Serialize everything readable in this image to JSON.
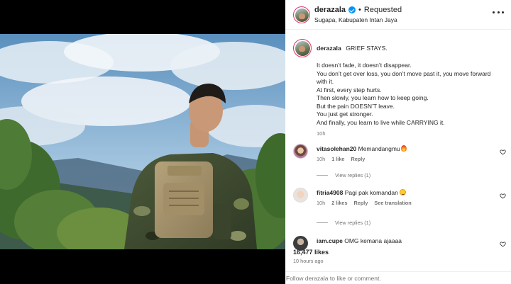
{
  "post": {
    "username": "derazala",
    "separator": "•",
    "follow_status": "Requested",
    "location": "Sugapa, Kabupaten Intan Jaya"
  },
  "caption": {
    "username": "derazala",
    "title": "GRIEF STAYS.",
    "lines": [
      "It doesn’t fade, it doesn’t disappear.",
      "You don’t get over loss, you don’t move past it, you move forward",
      "with it.",
      "At first, every step hurts.",
      "Then slowly, you learn how to keep going.",
      "But the pain DOESN’T leave.",
      "You just get stronger.",
      "And finally, you learn to live while CARRYING it."
    ],
    "time": "10h"
  },
  "comments": [
    {
      "username": "vitasolehan20",
      "text": "Memandangmu",
      "emoji": "fire-emoji",
      "time": "10h",
      "likes": "1 like",
      "reply": "Reply",
      "translate": "",
      "view_replies": "View replies (1)"
    },
    {
      "username": "fitria4908",
      "text": "Pagi pak komandan",
      "emoji": "smile-emoji",
      "time": "10h",
      "likes": "2 likes",
      "reply": "Reply",
      "translate": "See translation",
      "view_replies": "View replies (1)"
    },
    {
      "username": "iam.cupe",
      "text": "OMG kemana ajaaaa",
      "emoji": "",
      "time": "",
      "likes": "",
      "reply": "",
      "translate": "",
      "view_replies": ""
    }
  ],
  "stats": {
    "likes": "16,477 likes",
    "time_ago": "10 hours ago"
  },
  "footer": {
    "prompt": "Follow derazala to like or comment."
  },
  "icons": {
    "more": "more-options-icon",
    "verified": "verified-badge-icon",
    "heart": "heart-icon"
  },
  "colors": {
    "verified_blue": "#0095f6",
    "story_ring": "#e1306c",
    "muted_text": "#737373"
  }
}
